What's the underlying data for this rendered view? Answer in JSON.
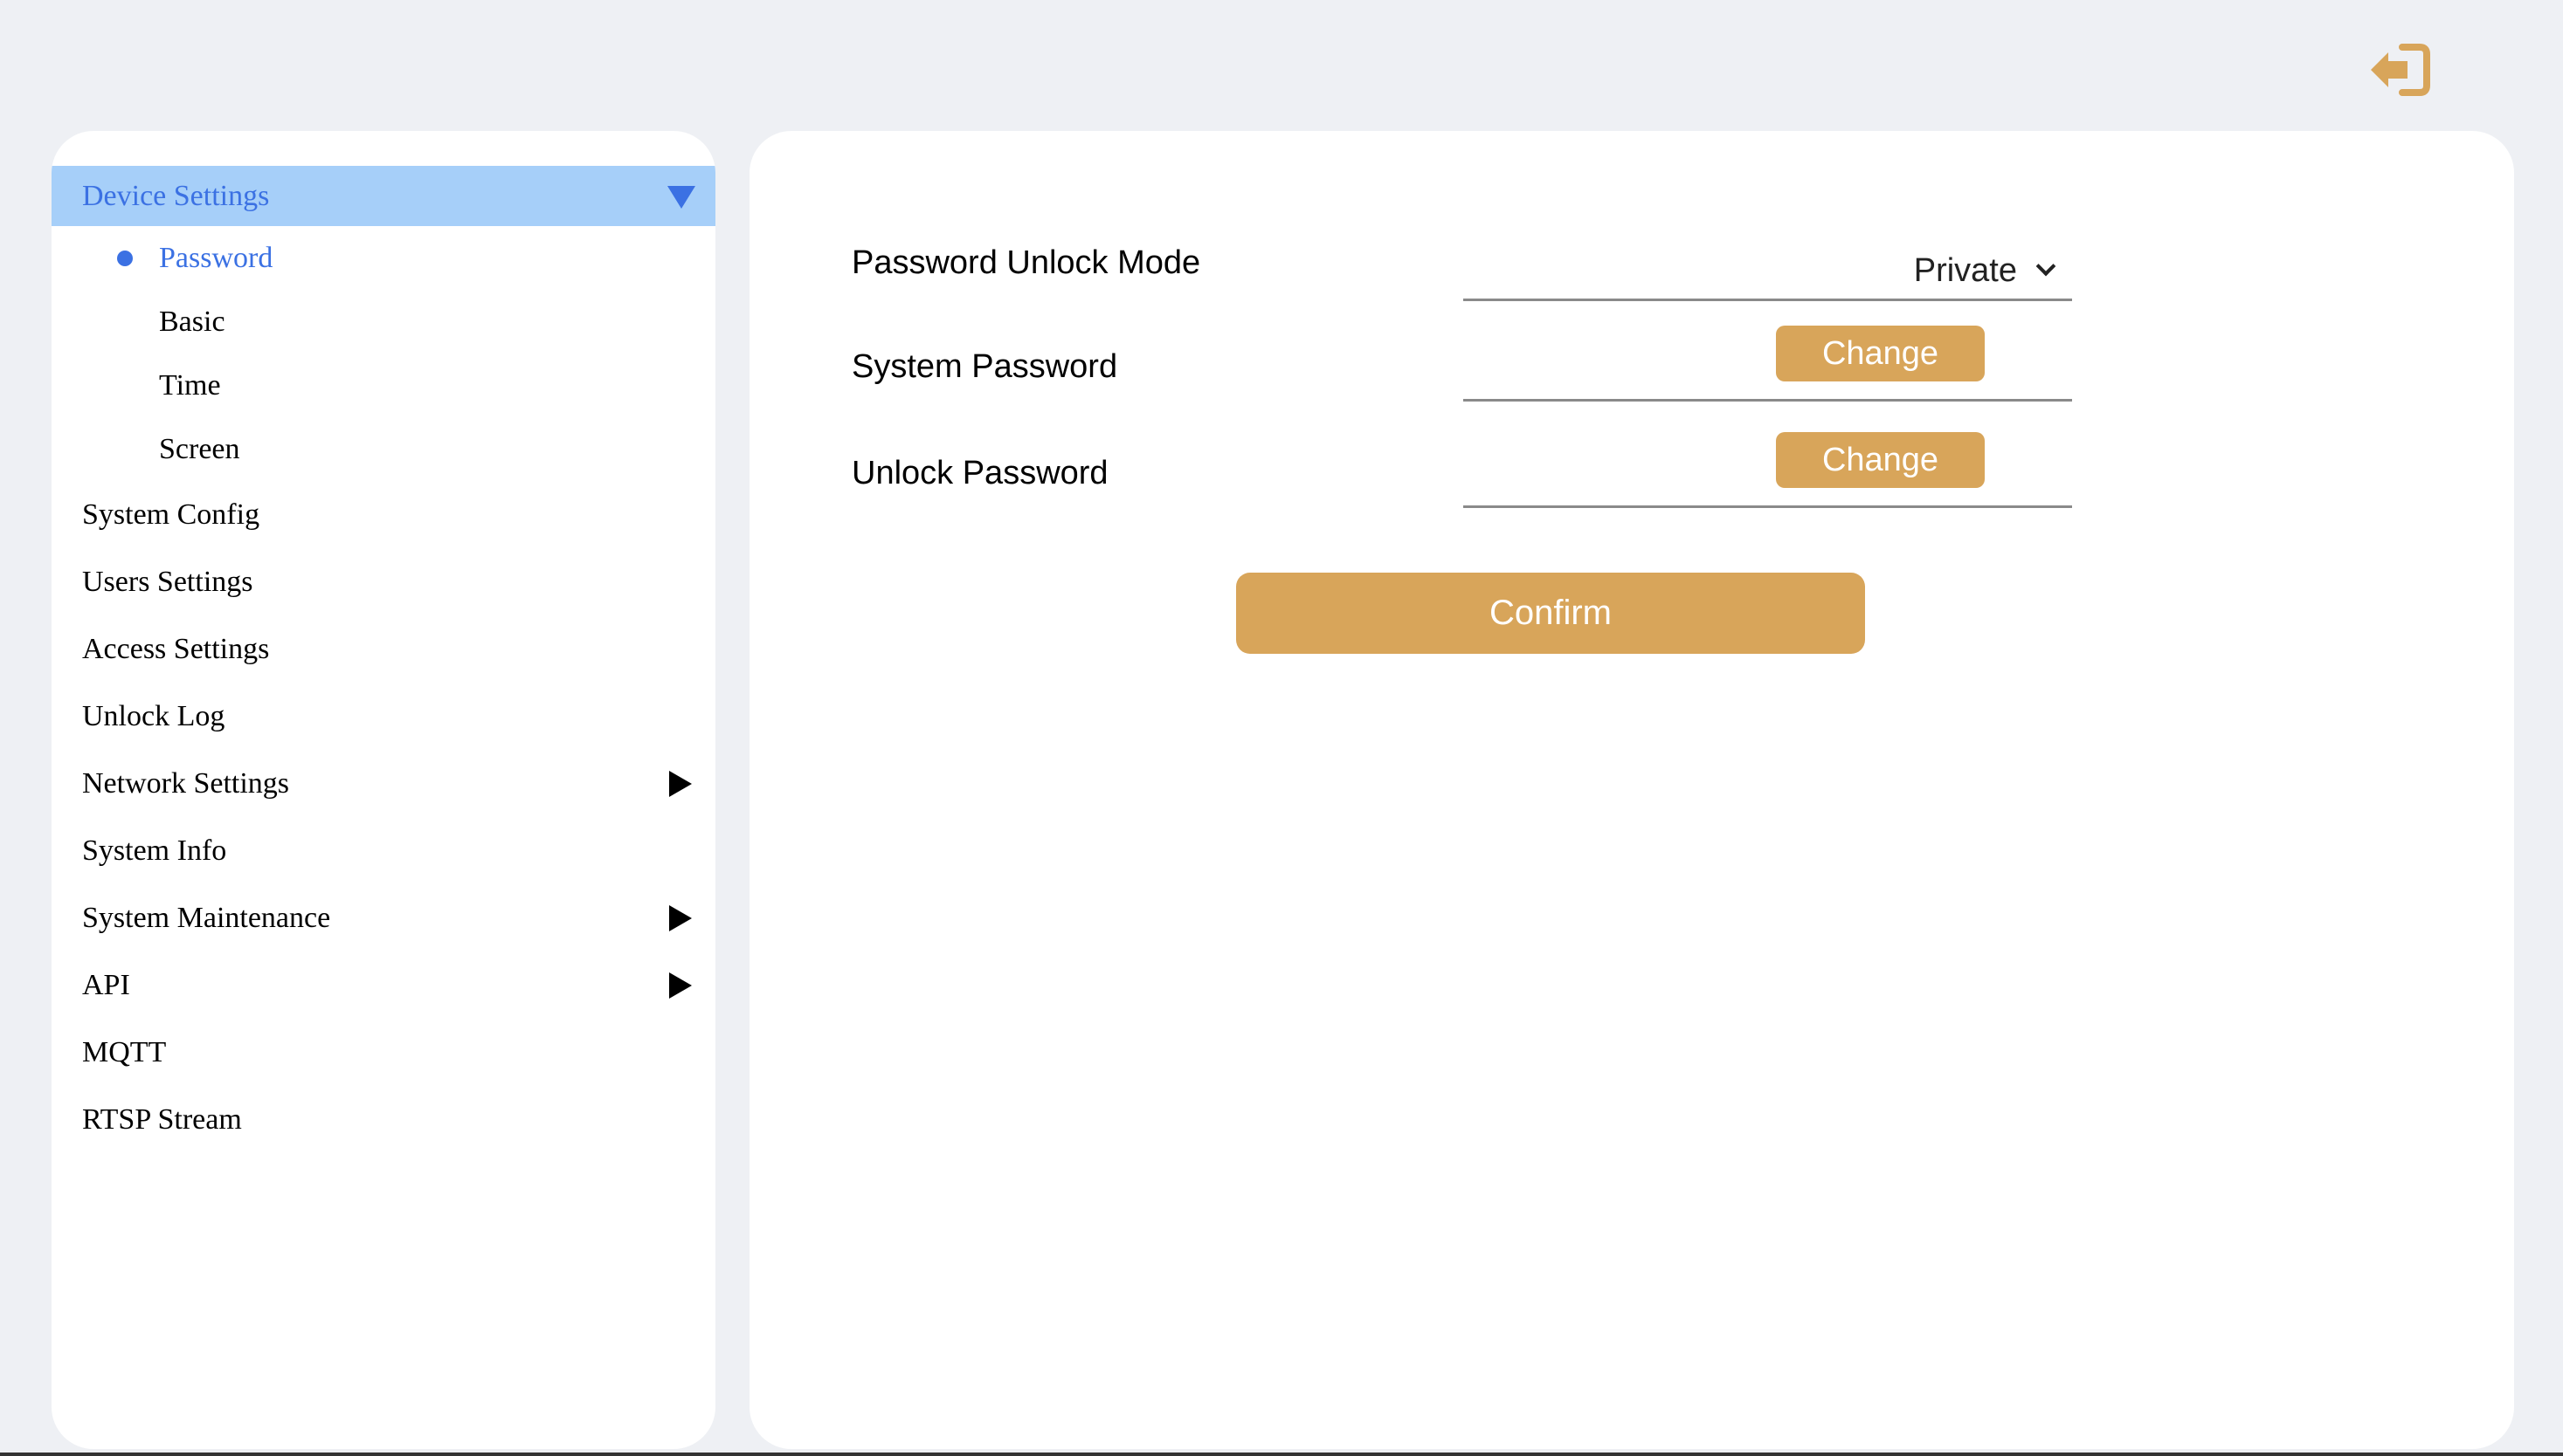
{
  "header": {
    "logout_icon": "logout-icon"
  },
  "colors": {
    "accent": "#d8a55a",
    "active_bg": "#a6cff9",
    "active_text": "#3b71e3",
    "page_bg": "#eef0f4"
  },
  "sidebar": {
    "items": [
      {
        "label": "Device Settings",
        "expanded": true,
        "active": true
      },
      {
        "label": "System Config"
      },
      {
        "label": "Users Settings"
      },
      {
        "label": "Access Settings"
      },
      {
        "label": "Unlock Log"
      },
      {
        "label": "Network Settings",
        "has_submenu": true
      },
      {
        "label": "System Info"
      },
      {
        "label": "System Maintenance",
        "has_submenu": true
      },
      {
        "label": "API",
        "has_submenu": true
      },
      {
        "label": "MQTT"
      },
      {
        "label": "RTSP Stream"
      }
    ],
    "device_settings_sub": [
      {
        "label": "Password",
        "active": true
      },
      {
        "label": "Basic"
      },
      {
        "label": "Time"
      },
      {
        "label": "Screen"
      }
    ]
  },
  "form": {
    "unlock_mode_label": "Password Unlock Mode",
    "unlock_mode_value": "Private",
    "system_password_label": "System Password",
    "unlock_password_label": "Unlock Password",
    "change_label": "Change",
    "confirm_label": "Confirm"
  }
}
